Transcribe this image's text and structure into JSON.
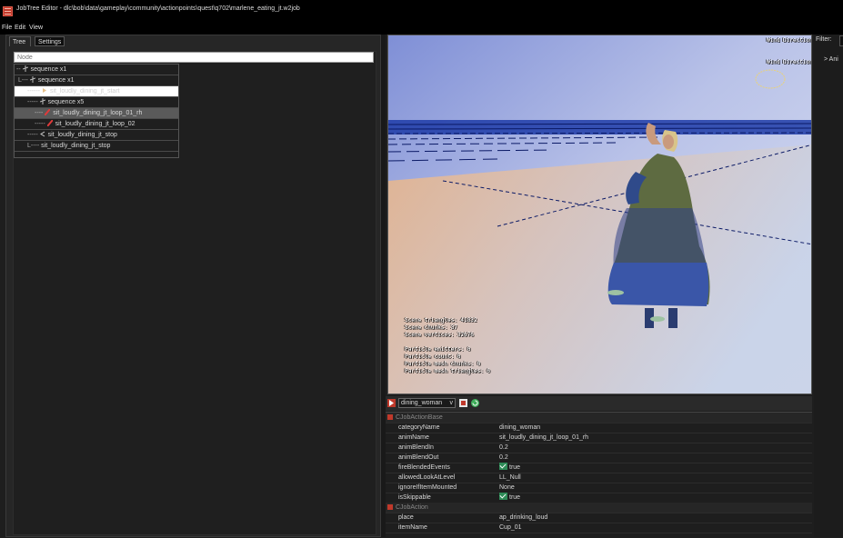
{
  "window": {
    "title": "JobTree Editor - dlc\\bob\\data\\gameplay\\community\\actionpoints\\quest\\q702\\marlene_eating_jt.w2job"
  },
  "menu": [
    "File",
    "Edit",
    "View"
  ],
  "tabs": {
    "tree": "Tree",
    "settings": "Settings"
  },
  "search": {
    "placeholder": "Node"
  },
  "tree": [
    {
      "label": "sequence x1",
      "kind": "sequence"
    },
    {
      "label": "sequence x1",
      "kind": "sequence"
    },
    {
      "label": "sit_loudly_dining_jt_start",
      "kind": "anim-disabled"
    },
    {
      "label": "sequence x5",
      "kind": "sequence"
    },
    {
      "label": "sit_loudly_dining_jt_loop_01_rh",
      "kind": "anim-active"
    },
    {
      "label": "sit_loudly_dining_jt_loop_02",
      "kind": "anim-red"
    },
    {
      "label": "sit_loudly_dining_jt_stop",
      "kind": "anim"
    },
    {
      "label": "sit_loudly_dining_jt_stop",
      "kind": "anim"
    }
  ],
  "viewport": {
    "wind_direction_1": "Wind Direction",
    "wind_direction_2": "Wind Direction",
    "stats": "Scene triangles: 41832\nScene chunks: 37\nScene vertices: 32676\n\nParticle emitters: 0\nParticle count: 0\nParticle mesh chunks: 0\nParticle mesh triangles: 0"
  },
  "right_panel": {
    "filter_label": "Filter:",
    "item": "Ani"
  },
  "toolbar": {
    "actor_select": "dining_woman"
  },
  "properties": {
    "sections": [
      {
        "title": "CJobActionBase",
        "rows": [
          {
            "key": "categoryName",
            "value": "dining_woman"
          },
          {
            "key": "animName",
            "value": "sit_loudly_dining_jt_loop_01_rh"
          },
          {
            "key": "animBlendIn",
            "value": "0.2"
          },
          {
            "key": "animBlendOut",
            "value": "0.2"
          },
          {
            "key": "fireBlendedEvents",
            "value": "true",
            "check": true
          },
          {
            "key": "allowedLookAtLevel",
            "value": "LL_Null"
          },
          {
            "key": "ignoreIfItemMounted",
            "value": "None"
          },
          {
            "key": "isSkippable",
            "value": "true",
            "check": true
          }
        ]
      },
      {
        "title": "CJobAction",
        "rows": [
          {
            "key": "place",
            "value": "ap_drinking_loud"
          },
          {
            "key": "itemName",
            "value": "Cup_01"
          }
        ]
      }
    ]
  },
  "colors": {
    "accent": "#c0392b",
    "check": "#2e8b57",
    "selection": "#5a5a5a"
  }
}
